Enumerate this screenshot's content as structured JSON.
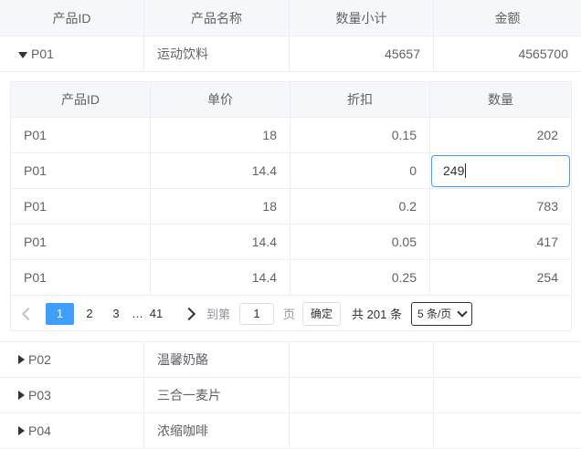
{
  "outer_table": {
    "headers": [
      "产品ID",
      "产品名称",
      "数量小计",
      "金额"
    ],
    "expanded_row": {
      "id": "P01",
      "name": "运动饮料",
      "qty": "45657",
      "amount": "4565700"
    },
    "collapsed_rows": [
      {
        "id": "P02",
        "name": "温馨奶酪"
      },
      {
        "id": "P03",
        "name": "三合一麦片"
      },
      {
        "id": "P04",
        "name": "浓缩咖啡"
      }
    ]
  },
  "inner_table": {
    "headers": [
      "产品ID",
      "单价",
      "折扣",
      "数量"
    ],
    "rows": [
      {
        "id": "P01",
        "price": "18",
        "discount": "0.15",
        "qty": "202"
      },
      {
        "id": "P01",
        "price": "14.4",
        "discount": "0",
        "qty": "249"
      },
      {
        "id": "P01",
        "price": "18",
        "discount": "0.2",
        "qty": "783"
      },
      {
        "id": "P01",
        "price": "14.4",
        "discount": "0.05",
        "qty": "417"
      },
      {
        "id": "P01",
        "price": "14.4",
        "discount": "0.25",
        "qty": "254"
      }
    ],
    "editing_value": "249"
  },
  "pagination": {
    "pages": [
      "1",
      "2",
      "3",
      "…",
      "41"
    ],
    "goto_label": "到第",
    "goto_value": "1",
    "page_unit": "页",
    "confirm_label": "确定",
    "total_label": "共 201 条",
    "page_size": "5 条/页"
  },
  "colors": {
    "accent": "#409eff",
    "header_bg": "#f5f7fa",
    "border": "#ebeef5"
  }
}
